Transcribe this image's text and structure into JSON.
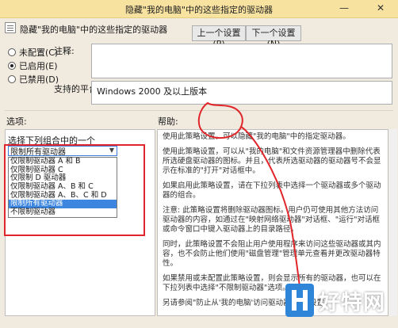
{
  "window": {
    "title": "隐藏\"我的电脑\"中的这些指定的驱动器",
    "minimize": "—",
    "close": "✕"
  },
  "header": {
    "setting_name": "隐藏\"我的电脑\"中的这些指定的驱动器",
    "prev_button": "上一个设置(P)",
    "next_button": "下一个设置(N)"
  },
  "state": {
    "options": [
      {
        "label": "未配置(C)",
        "checked": false
      },
      {
        "label": "已启用(E)",
        "checked": true
      },
      {
        "label": "已禁用(D)",
        "checked": false
      }
    ]
  },
  "comment_label": "注释:",
  "support_label": "支持的平台:",
  "support_value": "Windows 2000 及以上版本",
  "options_label": "选项:",
  "help_label": "帮助:",
  "options": {
    "select_label": "选择下列组合中的一个",
    "selected": "限制所有驱动器",
    "items": [
      "仅限制驱动器 A 和 B",
      "仅限制驱动器 C",
      "仅限制 D 驱动器",
      "仅限制驱动器 A、B 和 C",
      "仅限制驱动器 A、B、C 和 D",
      "限制所有驱动器",
      "不限制驱动器"
    ],
    "selected_index": 5
  },
  "help": {
    "paragraphs": [
      "使用此策略设置，可以隐藏\"我的电脑\"中的指定驱动器。",
      "使用此策略设置，可以从\"我的电脑\"和文件资源管理器中删除代表所选硬盘驱动器的图标。并且，代表所选驱动器的驱动器号不会显示在标准的\"打开\"对话框中。",
      "如果启用此策略设置，请在下拉列表中选择一个驱动器或多个驱动器的组合。",
      "注意: 此策略设置将删除驱动器图标。用户仍可使用其他方法访问驱动器的内容，如通过在\"映射网络驱动器\"对话框、\"运行\"对话框或命令窗口中键入驱动器上的目录路径。",
      "同时，此策略设置不会阻止用户使用程序来访问这些驱动器或其内容，也不会防止他们使用\"磁盘管理\"管理单元查看并更改驱动器特性。",
      "如果禁用或未配置此策略设置，则会显示所有的驱动器，也可以在下拉列表中选择\"不限制驱动器\"选项。",
      "另请参阅\"防止从'我的电脑'访问驱动器\"策略设置。"
    ]
  },
  "watermark": {
    "text": "好特网"
  },
  "colors": {
    "titlebar": "#f7e2a0",
    "annotation": "#e0262a",
    "selection": "#3d86e0",
    "watermark_logo": "#2f86d8"
  }
}
